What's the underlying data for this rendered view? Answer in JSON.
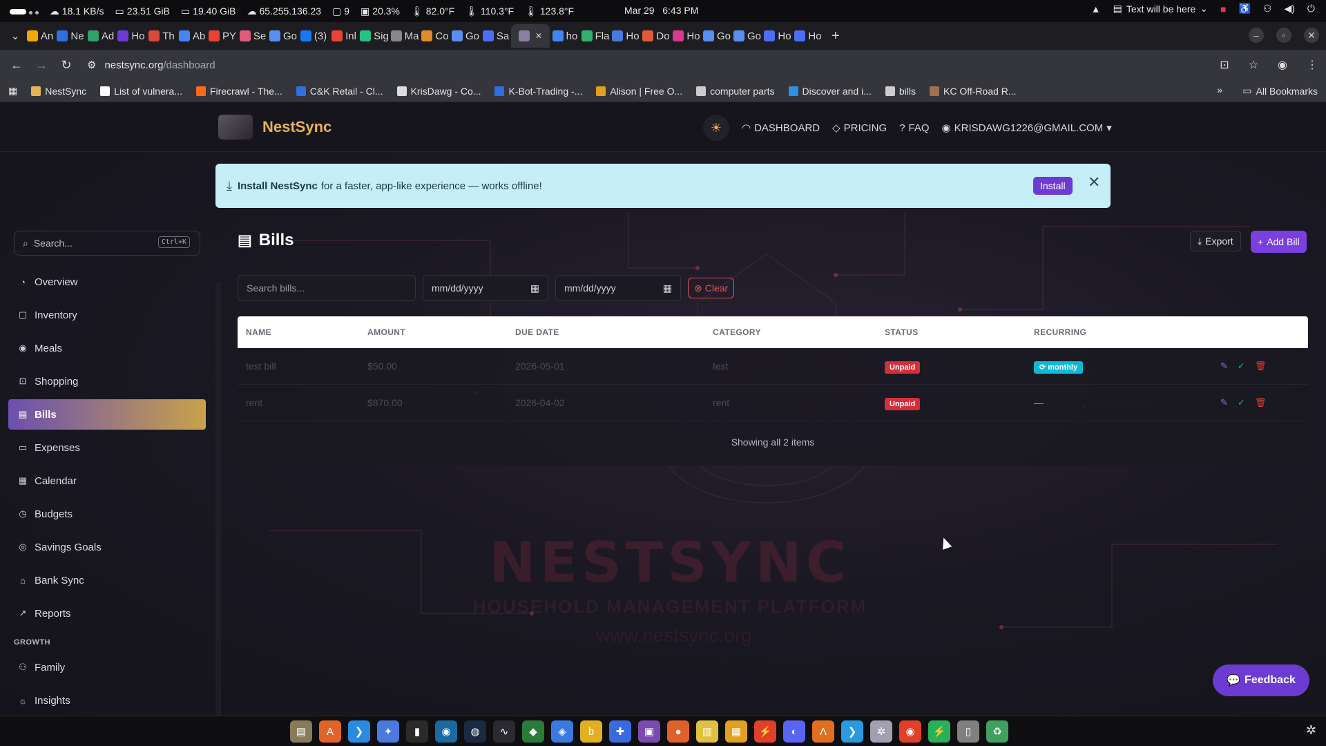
{
  "system_bar": {
    "net_speed": "18.1 KB/s",
    "mem1": "23.51 GiB",
    "mem2": "19.40 GiB",
    "ip": "65.255.136.23",
    "windows": "9",
    "cpu": "20.3%",
    "temp1": "82.0°F",
    "temp2": "110.3°F",
    "temp3": "123.8°F",
    "clock": "Mar 29   6:43 PM",
    "notice": "Text will be here"
  },
  "tabs": [
    {
      "label": "An",
      "color": "#f2a900"
    },
    {
      "label": "Ne",
      "color": "#2f6fe0"
    },
    {
      "label": "Ad",
      "color": "#31a06a"
    },
    {
      "label": "Ho",
      "color": "#6c3bd1"
    },
    {
      "label": "Th",
      "color": "#d84a3a"
    },
    {
      "label": "Ab",
      "color": "#4285f4"
    },
    {
      "label": "PY",
      "color": "#ea4335"
    },
    {
      "label": "Se",
      "color": "#e05a7a"
    },
    {
      "label": "Go",
      "color": "#5a8df0"
    },
    {
      "label": "(3)",
      "color": "#1877f2"
    },
    {
      "label": "Inl",
      "color": "#ea4335"
    },
    {
      "label": "Sig",
      "color": "#26c281"
    },
    {
      "label": "Ma",
      "color": "#888888"
    },
    {
      "label": "Co",
      "color": "#e08a2a"
    },
    {
      "label": "Go",
      "color": "#5a8df0"
    },
    {
      "label": "Sa",
      "color": "#4c6ef5"
    },
    {
      "label": "",
      "color": "#8a7fa0"
    },
    {
      "label": "ho",
      "color": "#4285f4"
    },
    {
      "label": "Fla",
      "color": "#2fb36a"
    },
    {
      "label": "Ho",
      "color": "#4a7ae0"
    },
    {
      "label": "Do",
      "color": "#e05a3a"
    },
    {
      "label": "Ho",
      "color": "#d83a8a"
    },
    {
      "label": "Go",
      "color": "#5a8df0"
    },
    {
      "label": "Go",
      "color": "#5a8df0"
    },
    {
      "label": "Ho",
      "color": "#4c6ef5"
    },
    {
      "label": "Ho",
      "color": "#4c6ef5"
    }
  ],
  "address": {
    "host": "nestsync.org",
    "path": "/dashboard"
  },
  "bookmarks": [
    {
      "label": "NestSync",
      "color": "#e6b35c"
    },
    {
      "label": "List of vulnera...",
      "color": "#ffffff"
    },
    {
      "label": "Firecrawl - The...",
      "color": "#ff6a1a"
    },
    {
      "label": "C&K Retail - Cl...",
      "color": "#2f6fe0"
    },
    {
      "label": "KrisDawg - Co...",
      "color": "#dddddd"
    },
    {
      "label": "K-Bot-Trading -...",
      "color": "#2f6fe0"
    },
    {
      "label": "Alison | Free O...",
      "color": "#e0a020"
    },
    {
      "label": "computer parts",
      "color": "#cccccc"
    },
    {
      "label": "Discover and i...",
      "color": "#2f8fe0"
    },
    {
      "label": "bills",
      "color": "#cccccc"
    },
    {
      "label": "KC Off-Road R...",
      "color": "#a07050"
    }
  ],
  "bookmarks_more": "»",
  "bookmarks_all": "All Bookmarks",
  "app": {
    "brand": "NestSync",
    "nav": {
      "dashboard": "DASHBOARD",
      "pricing": "PRICING",
      "faq": "FAQ",
      "account": "KRISDAWG1226@GMAIL.COM"
    },
    "banner": {
      "bold": "Install NestSync",
      "text": "for a faster, app-like experience — works offline!",
      "install": "Install"
    },
    "sidebar": {
      "search_placeholder": "Search...",
      "shortcut": "Ctrl+K",
      "items": [
        {
          "label": "Overview",
          "icon": "◔"
        },
        {
          "label": "Inventory",
          "icon": "▢"
        },
        {
          "label": "Meals",
          "icon": "◉"
        },
        {
          "label": "Shopping",
          "icon": "⊡"
        },
        {
          "label": "Bills",
          "icon": "▤",
          "active": true
        },
        {
          "label": "Expenses",
          "icon": "▭"
        },
        {
          "label": "Calendar",
          "icon": "▦"
        },
        {
          "label": "Budgets",
          "icon": "◷"
        },
        {
          "label": "Savings Goals",
          "icon": "◎"
        },
        {
          "label": "Bank Sync",
          "icon": "⌂"
        },
        {
          "label": "Reports",
          "icon": "↗"
        }
      ],
      "growth_label": "GROWTH",
      "growth_items": [
        {
          "label": "Family",
          "icon": "⚇"
        },
        {
          "label": "Insights",
          "icon": "☼"
        }
      ]
    },
    "page_title": "Bills",
    "export_label": "Export",
    "add_label": "Add Bill",
    "filters": {
      "search_placeholder": "Search bills...",
      "date_from": "mm/dd/yyyy",
      "date_to": "mm/dd/yyyy",
      "clear": "Clear"
    },
    "table": {
      "headers": [
        "NAME",
        "AMOUNT",
        "DUE DATE",
        "CATEGORY",
        "STATUS",
        "RECURRING"
      ],
      "rows": [
        {
          "name": "test bill",
          "amount": "$50.00",
          "due": "2026-05-01",
          "category": "test",
          "status": "Unpaid",
          "recurring": "monthly"
        },
        {
          "name": "rent",
          "amount": "$870.00",
          "due": "2026-04-02",
          "category": "rent",
          "status": "Unpaid",
          "recurring": "—"
        }
      ],
      "footer": "Showing all 2 items"
    },
    "watermark": {
      "big": "NESTSYNC",
      "sub": "HOUSEHOLD MANAGEMENT PLATFORM",
      "url": "www.nestsync.org"
    },
    "feedback": "Feedback"
  },
  "taskbar": {
    "icons": [
      {
        "name": "files",
        "color": "#8a7a5a",
        "glyph": "▤"
      },
      {
        "name": "store",
        "color": "#e0642a",
        "glyph": "A"
      },
      {
        "name": "vscode",
        "color": "#2a8ae0",
        "glyph": "❯"
      },
      {
        "name": "gemini",
        "color": "#4a7ae0",
        "glyph": "✦"
      },
      {
        "name": "terminal",
        "color": "#2a2a2a",
        "glyph": "▮"
      },
      {
        "name": "chrome-canary",
        "color": "#1a6aa0",
        "glyph": "◉"
      },
      {
        "name": "steam",
        "color": "#1a2a40",
        "glyph": "◍"
      },
      {
        "name": "monitor",
        "color": "#2a2a30",
        "glyph": "∿"
      },
      {
        "name": "game",
        "color": "#2a7a3a",
        "glyph": "◆"
      },
      {
        "name": "copilot",
        "color": "#3a7ae0",
        "glyph": "◈"
      },
      {
        "name": "app-yellow",
        "color": "#e0b020",
        "glyph": "b"
      },
      {
        "name": "extensions",
        "color": "#3a6ae0",
        "glyph": "✚"
      },
      {
        "name": "chat",
        "color": "#7a4ab0",
        "glyph": "▣"
      },
      {
        "name": "firefox",
        "color": "#e0602a",
        "glyph": "●"
      },
      {
        "name": "notes",
        "color": "#e0c040",
        "glyph": "▥"
      },
      {
        "name": "office",
        "color": "#e0a020",
        "glyph": "▦"
      },
      {
        "name": "flash",
        "color": "#e0402a",
        "glyph": "⚡"
      },
      {
        "name": "discord",
        "color": "#5865f2",
        "glyph": "◐"
      },
      {
        "name": "blender",
        "color": "#e07020",
        "glyph": "Λ"
      },
      {
        "name": "vscode2",
        "color": "#2a9ae0",
        "glyph": "❯"
      },
      {
        "name": "settings",
        "color": "#a0a0b0",
        "glyph": "✲"
      },
      {
        "name": "chrome",
        "color": "#e0402a",
        "glyph": "◉"
      },
      {
        "name": "bolt",
        "color": "#2ab05a",
        "glyph": "⚡"
      },
      {
        "name": "device",
        "color": "#808080",
        "glyph": "▯"
      },
      {
        "name": "trash",
        "color": "#40a060",
        "glyph": "♻"
      }
    ]
  }
}
